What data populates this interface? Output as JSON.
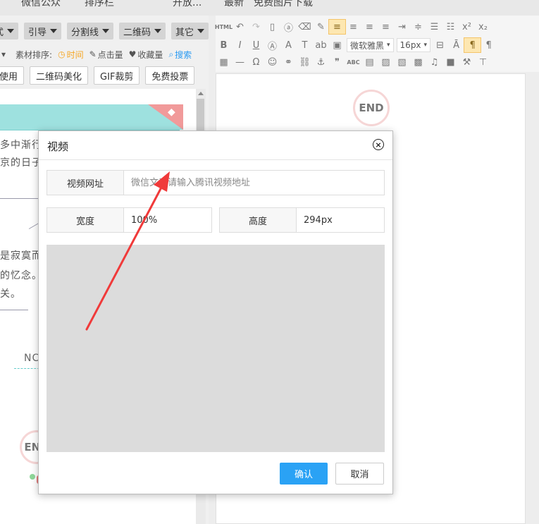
{
  "top_strip": {
    "fragments": [
      "微信公众",
      "排序栏",
      "开放...",
      "最新",
      "免费图片下载"
    ]
  },
  "left_panel": {
    "categories": [
      {
        "label": "式"
      },
      {
        "label": "引导"
      },
      {
        "label": "分割线"
      },
      {
        "label": "二维码"
      },
      {
        "label": "其它"
      }
    ],
    "sort": {
      "label": "素材排序:",
      "options": [
        {
          "label": "时间",
          "icon": "clock-icon"
        },
        {
          "label": "点击量",
          "icon": "click-icon"
        },
        {
          "label": "收藏量",
          "icon": "heart-icon"
        },
        {
          "label": "搜索",
          "icon": "search-icon"
        }
      ],
      "partial_left": "▾"
    },
    "tools": [
      {
        "label": "使用"
      },
      {
        "label": "二维码美化"
      },
      {
        "label": "GIF裁剪"
      },
      {
        "label": "免费投票"
      }
    ],
    "content": {
      "text1": "多中渐行",
      "text2": "京的日子",
      "text3": "是寂寞而",
      "text4": "的忆念。",
      "text5": "关。",
      "text6": "NC",
      "end_label": "END"
    }
  },
  "editor": {
    "html_label": "HTML",
    "font_family": "微软雅黑",
    "font_size": "16px",
    "end_label": "END"
  },
  "dialog": {
    "title": "视频",
    "close_symbol": "×",
    "url_label": "视频网址",
    "url_placeholder": "微信文章请输入腾讯视频地址",
    "width_label": "宽度",
    "width_value": "100%",
    "height_label": "高度",
    "height_value": "294px",
    "confirm_label": "确认",
    "cancel_label": "取消"
  },
  "colors": {
    "accent_blue": "#2aa2f5",
    "arrow_red": "#f03a3a",
    "banner_teal": "#9ee1df",
    "preview_gray": "#dcdcdc"
  }
}
